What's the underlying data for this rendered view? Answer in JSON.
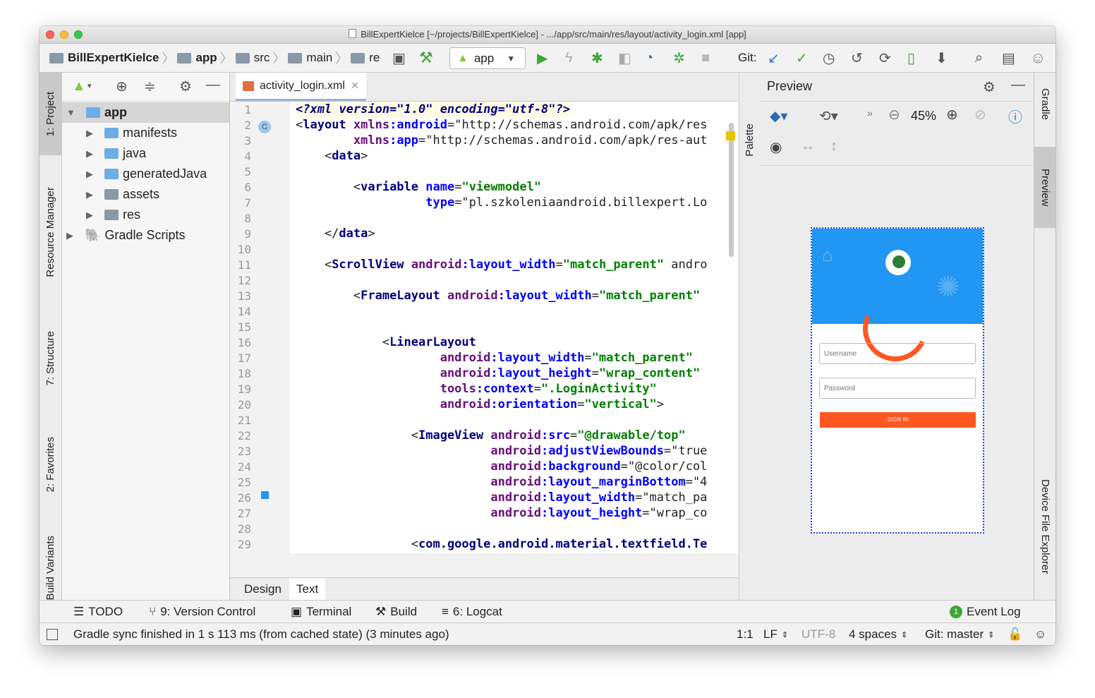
{
  "window": {
    "title": "BillExpertKielce [~/projects/BillExpertKielce] - .../app/src/main/res/layout/activity_login.xml [app]"
  },
  "toolbar": {
    "breadcrumbs": [
      "BillExpertKielce",
      "app",
      "src",
      "main",
      "re"
    ],
    "run_config": "app",
    "git_label": "Git:"
  },
  "left_tabs": [
    "1: Project",
    "Resource Manager",
    "7: Structure",
    "2: Favorites",
    "Build Variants"
  ],
  "right_tabs": [
    "Gradle",
    "Preview",
    "Device File Explorer"
  ],
  "project": {
    "items": [
      {
        "label": "app",
        "bold": true
      },
      {
        "label": "manifests"
      },
      {
        "label": "java"
      },
      {
        "label": "generatedJava"
      },
      {
        "label": "assets"
      },
      {
        "label": "res"
      },
      {
        "label": "Gradle Scripts"
      }
    ]
  },
  "editor": {
    "tab": "activity_login.xml",
    "bottom_tabs": [
      "Design",
      "Text"
    ],
    "line_numbers": [
      "1",
      "2",
      "3",
      "4",
      "5",
      "6",
      "7",
      "8",
      "9",
      "10",
      "11",
      "12",
      "13",
      "14",
      "15",
      "16",
      "17",
      "18",
      "19",
      "20",
      "21",
      "22",
      "23",
      "24",
      "25",
      "26",
      "27",
      "28",
      "29"
    ],
    "lines": [
      "<?xml version=\"1.0\" encoding=\"utf-8\"?>",
      "<layout xmlns:android=\"http://schemas.android.com/apk/res",
      "        xmlns:app=\"http://schemas.android.com/apk/res-aut",
      "    <data>",
      "",
      "        <variable name=\"viewmodel\"",
      "                  type=\"pl.szkoleniaandroid.billexpert.Lo",
      "",
      "    </data>",
      "",
      "    <ScrollView android:layout_width=\"match_parent\" andro",
      "",
      "        <FrameLayout android:layout_width=\"match_parent\" ",
      "",
      "",
      "            <LinearLayout",
      "                    android:layout_width=\"match_parent\"",
      "                    android:layout_height=\"wrap_content\"",
      "                    tools:context=\".LoginActivity\"",
      "                    android:orientation=\"vertical\">",
      "",
      "                <ImageView android:src=\"@drawable/top\"",
      "                           android:adjustViewBounds=\"true",
      "                           android:background=\"@color/col",
      "                           android:layout_marginBottom=\"4",
      "                           android:layout_width=\"match_pa",
      "                           android:layout_height=\"wrap_co",
      "",
      "                <com.google.android.material.textfield.Te"
    ]
  },
  "preview": {
    "title": "Preview",
    "palette_label": "Palette",
    "zoom": "45%",
    "username_hint": "Username",
    "password_hint": "Password",
    "sign_in": "SIGN IN"
  },
  "tool_windows": [
    "TODO",
    "9: Version Control",
    "Terminal",
    "Build",
    "6: Logcat",
    "Event Log"
  ],
  "status": {
    "message": "Gradle sync finished in 1 s 113 ms (from cached state) (3 minutes ago)",
    "position": "1:1",
    "line_sep": "LF",
    "encoding": "UTF-8",
    "indent": "4 spaces",
    "git": "Git: master"
  },
  "colors": {
    "accent": "#2196f3",
    "sign_in": "#ff5722",
    "spinner": "#ff5722",
    "run_green": "#3ea639"
  }
}
